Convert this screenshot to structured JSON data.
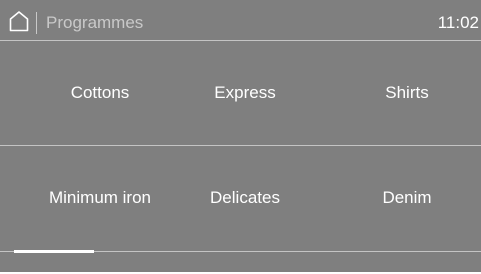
{
  "header": {
    "home_icon": "home-icon",
    "title": "Programmes",
    "time": "11:02"
  },
  "programmes": [
    {
      "label": "Cottons"
    },
    {
      "label": "Express"
    },
    {
      "label": "Shirts"
    },
    {
      "label": "Minimum iron"
    },
    {
      "label": "Delicates"
    },
    {
      "label": "Denim"
    }
  ],
  "pagination": {
    "current_page": 1
  },
  "colors": {
    "background": "#7f7f7f",
    "text": "#ffffff",
    "muted_text": "#c9c9c9",
    "divider": "#c4c4c4"
  }
}
